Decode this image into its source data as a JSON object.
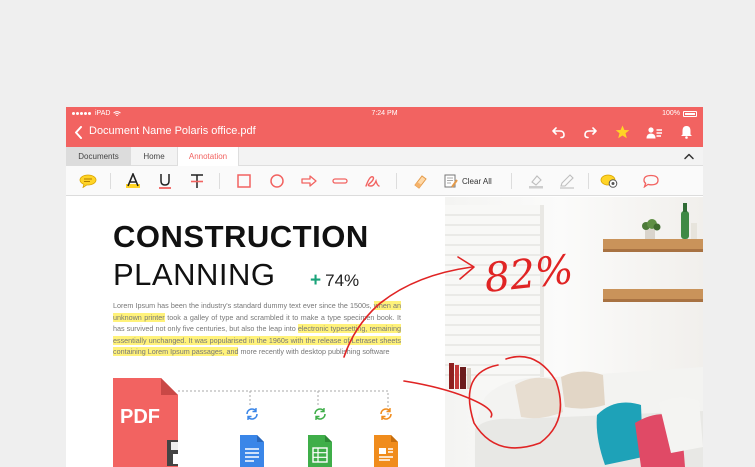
{
  "status": {
    "device": "iPAD",
    "time": "7:24 PM",
    "battery": "100%"
  },
  "titlebar": {
    "title": "Document Name Polaris office.pdf",
    "icons": [
      "back-icon",
      "undo-icon",
      "redo-icon",
      "star-icon",
      "share-user-icon",
      "bell-icon"
    ]
  },
  "tabs": [
    {
      "label": "Documents"
    },
    {
      "label": "Home"
    },
    {
      "label": "Annotation",
      "active": true
    }
  ],
  "toolbar": {
    "clear_all": "Clear All",
    "tools": [
      "note-icon",
      "text-highlight-icon",
      "underline-icon",
      "strikethrough-icon",
      "rectangle-icon",
      "ellipse-icon",
      "arrow-icon",
      "line-icon",
      "freehand-icon",
      "eraser-icon",
      "clear-all-icon",
      "fill-icon",
      "edit-icon",
      "show-notes-icon",
      "comment-icon"
    ]
  },
  "document": {
    "heading1": "CONSTRUCTION",
    "heading2": "PLANNING",
    "stat_sign": "+",
    "stat_value": "74%",
    "body": {
      "t1": "Lorem Ipsum has been the industry's standard dummy text ever since the 1500s,",
      "h1": "when an unknown printer",
      "t2": " took a galley of type and scrambled it to make a type specimen book. It has survived not only five centuries, but also the leap into ",
      "h2": "electronic typesetting, remaining essentially unchanged. It was popularised in the 1960s with the release of Letraset sheets containing Lorem Ipsum passages, and",
      "t3": " more recently with desktop publishing software"
    },
    "pdf_label": "PDF",
    "handwritten": "82%"
  },
  "colors": {
    "accent": "#f26361",
    "highlight": "#fff27a",
    "ink": "#e02424",
    "green": "#1aa37a"
  }
}
